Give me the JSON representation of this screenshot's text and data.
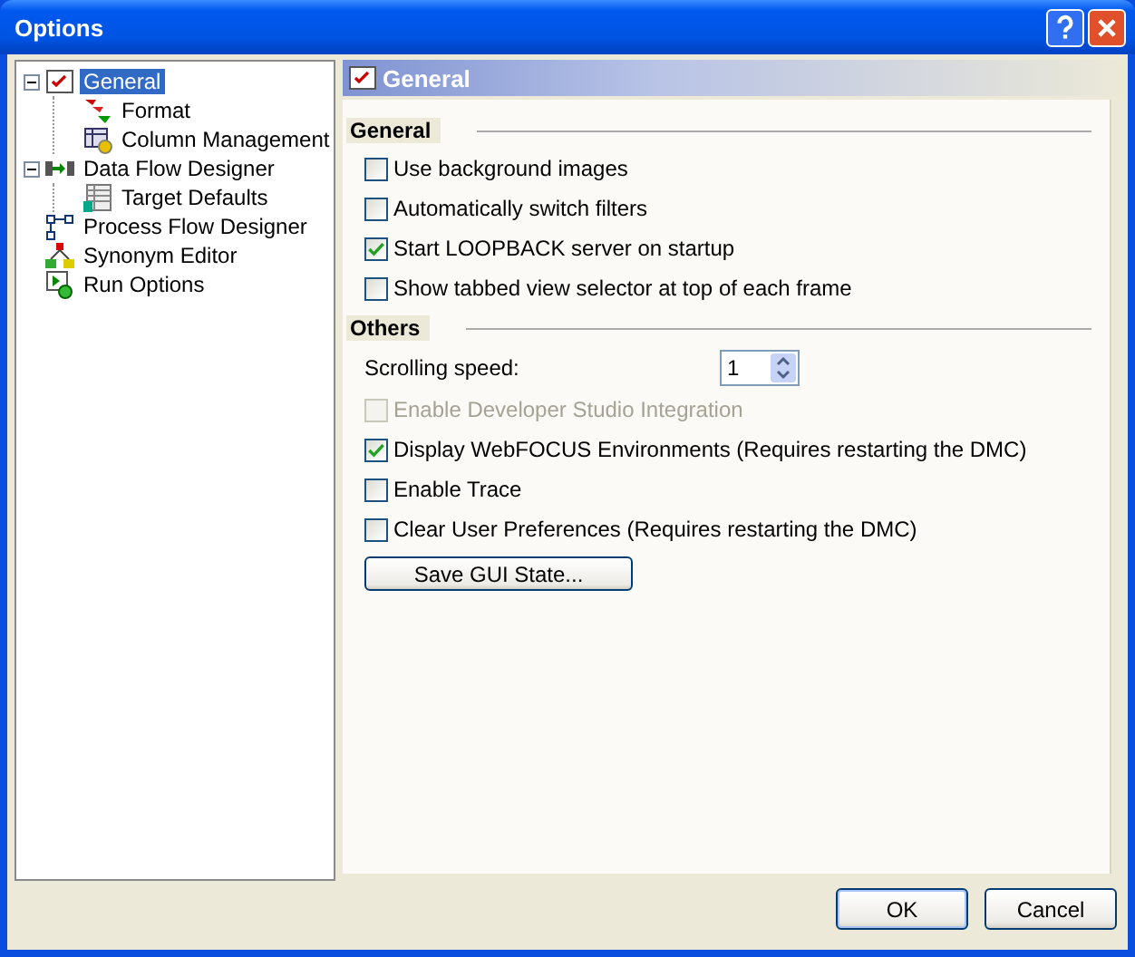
{
  "window": {
    "title": "Options"
  },
  "tree": [
    {
      "label": "General",
      "selected": true,
      "expanded": true,
      "children": [
        {
          "label": "Format",
          "selected": false
        },
        {
          "label": "Column Management",
          "selected": false
        }
      ]
    },
    {
      "label": "Data Flow Designer",
      "selected": false,
      "expanded": true,
      "children": [
        {
          "label": "Target Defaults",
          "selected": false
        }
      ]
    },
    {
      "label": "Process Flow Designer",
      "selected": false
    },
    {
      "label": "Synonym Editor",
      "selected": false
    },
    {
      "label": "Run Options",
      "selected": false
    }
  ],
  "panel": {
    "title": "General",
    "groups": [
      {
        "heading": "General",
        "items": [
          {
            "kind": "checkbox",
            "label": "Use background images",
            "checked": false,
            "disabled": false
          },
          {
            "kind": "checkbox",
            "label": "Automatically switch filters",
            "checked": false,
            "disabled": false
          },
          {
            "kind": "checkbox",
            "label": "Start LOOPBACK server on startup",
            "checked": true,
            "disabled": false
          },
          {
            "kind": "checkbox",
            "label": "Show tabbed view selector at top of each frame",
            "checked": false,
            "disabled": false
          }
        ]
      },
      {
        "heading": "Others",
        "items": [
          {
            "kind": "spinner",
            "label": "Scrolling speed:",
            "value": "1"
          },
          {
            "kind": "checkbox",
            "label": "Enable Developer Studio Integration",
            "checked": false,
            "disabled": true
          },
          {
            "kind": "checkbox",
            "label": "Display WebFOCUS Environments (Requires restarting the DMC)",
            "checked": true,
            "disabled": false
          },
          {
            "kind": "checkbox",
            "label": "Enable Trace",
            "checked": false,
            "disabled": false
          },
          {
            "kind": "checkbox",
            "label": "Clear User Preferences (Requires restarting the DMC)",
            "checked": false,
            "disabled": false
          },
          {
            "kind": "button",
            "label": "Save GUI State..."
          }
        ]
      }
    ]
  },
  "buttons": [
    "OK",
    "Cancel"
  ]
}
